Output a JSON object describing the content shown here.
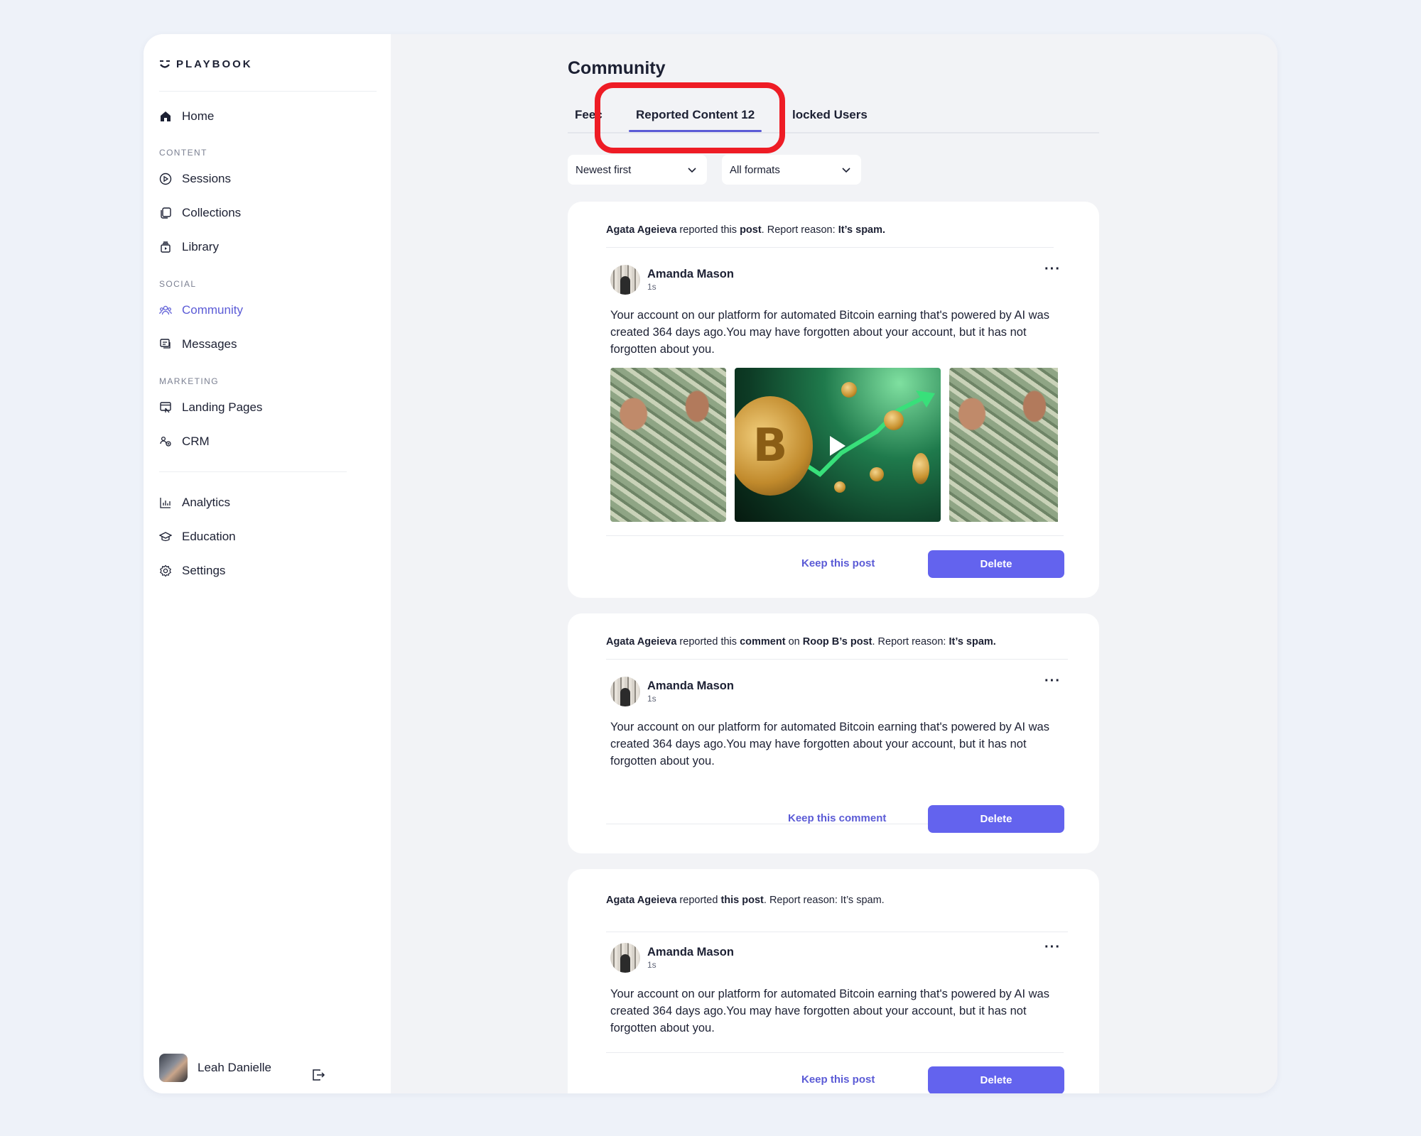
{
  "brand": {
    "name": "PLAYBOOK"
  },
  "sidebar": {
    "home": "Home",
    "sections": {
      "content": "CONTENT",
      "social": "SOCIAL",
      "marketing": "MARKETING"
    },
    "items": {
      "sessions": "Sessions",
      "collections": "Collections",
      "library": "Library",
      "community": "Community",
      "messages": "Messages",
      "landing_pages": "Landing Pages",
      "crm": "CRM",
      "analytics": "Analytics",
      "education": "Education",
      "settings": "Settings"
    },
    "active_item": "community",
    "user": {
      "name": "Leah Danielle"
    }
  },
  "page": {
    "title": "Community",
    "tabs": [
      {
        "label": "Feed",
        "visible_label": "Feec"
      },
      {
        "label": "Reported Content 12",
        "active": true
      },
      {
        "label": "Blocked Users",
        "visible_label": "locked Users"
      }
    ],
    "filters": {
      "sort": "Newest first",
      "format": "All formats"
    }
  },
  "reports": [
    {
      "reporter": "Agata Ageieva",
      "reported_text": "reported this",
      "item_type": "post",
      "reason_label": "Report reason:",
      "reason": "It’s spam.",
      "author": "Amanda Mason",
      "time": "1s",
      "more": "···",
      "text": "Your account on our platform for automated Bitcoin earning that's powered by AI was created 364 days ago.You may have forgotten about your account, but it has not forgotten about you.",
      "keep_label": "Keep this post",
      "delete_label": "Delete"
    },
    {
      "reporter": "Agata Ageieva",
      "reported_text": "reported this",
      "item_type": "comment",
      "on_text": "on",
      "target": "Roop B’s post",
      "reason_label": "Report reason:",
      "reason": "It’s spam.",
      "author": "Amanda Mason",
      "time": "1s",
      "more": "···",
      "text": "Your account on our platform for automated Bitcoin earning that's powered by AI was created 364 days ago.You may have forgotten about your account, but it has not forgotten about you.",
      "keep_label": "Keep this comment",
      "delete_label": "Delete"
    },
    {
      "reporter": "Agata Ageieva",
      "reported_text": "reported",
      "item_type": "this post",
      "reason_label": "Report reason:",
      "reason": "It’s spam.",
      "author": "Amanda Mason",
      "time": "1s",
      "more": "···",
      "text": "Your account on our platform for automated Bitcoin earning that's powered by AI was created 364 days ago.You may have forgotten about your account, but it has not forgotten about you.",
      "keep_label": "Keep this post",
      "delete_label": "Delete"
    }
  ],
  "colors": {
    "accent": "#5b5bd6",
    "button": "#6363ee",
    "highlight": "#ee1c25",
    "background": "#eef2f9"
  }
}
